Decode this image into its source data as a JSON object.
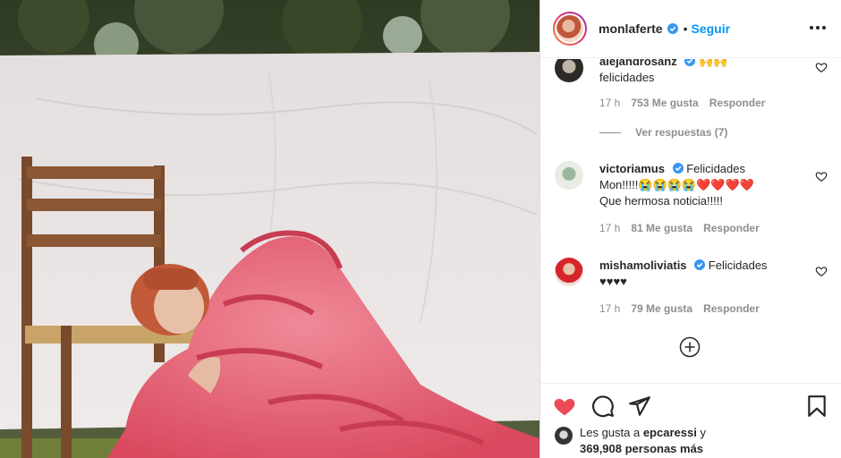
{
  "post": {
    "username": "monlaferte",
    "separator": "•",
    "follow_label": "Seguir"
  },
  "comments": [
    {
      "username": "alejandrosanz",
      "emoji": "🙌🙌",
      "text": "felicidades",
      "time": "17 h",
      "likes": "753 Me gusta",
      "reply_label": "Responder",
      "view_replies": "Ver respuestas (7)"
    },
    {
      "username": "victoriamus",
      "text_line1": "Felicidades",
      "text_line2": "Mon!!!!!😭😭😭😭❤️❤️❤️❤️",
      "text_line3": "Que hermosa noticia!!!!!",
      "time": "17 h",
      "likes": "81 Me gusta",
      "reply_label": "Responder"
    },
    {
      "username": "mishamoliviatis",
      "text_line1": "Felicidades",
      "text_line2": "♥♥♥♥",
      "time": "17 h",
      "likes": "79 Me gusta",
      "reply_label": "Responder"
    }
  ],
  "likes": {
    "prefix": "Les gusta a ",
    "user": "epcaressi",
    "conjunction": " y",
    "count": "369,908 personas más"
  },
  "icons": {
    "like": "heart-filled-icon",
    "comment": "comment-bubble-icon",
    "share": "paper-plane-icon",
    "save": "bookmark-icon",
    "more": "more-horizontal-icon",
    "load_more": "plus-circle-icon",
    "verified": "verified-badge-icon"
  },
  "colors": {
    "accent": "#0095f6",
    "like_red": "#ed4956",
    "verified": "#3897f0",
    "muted": "#8e8e8e"
  }
}
